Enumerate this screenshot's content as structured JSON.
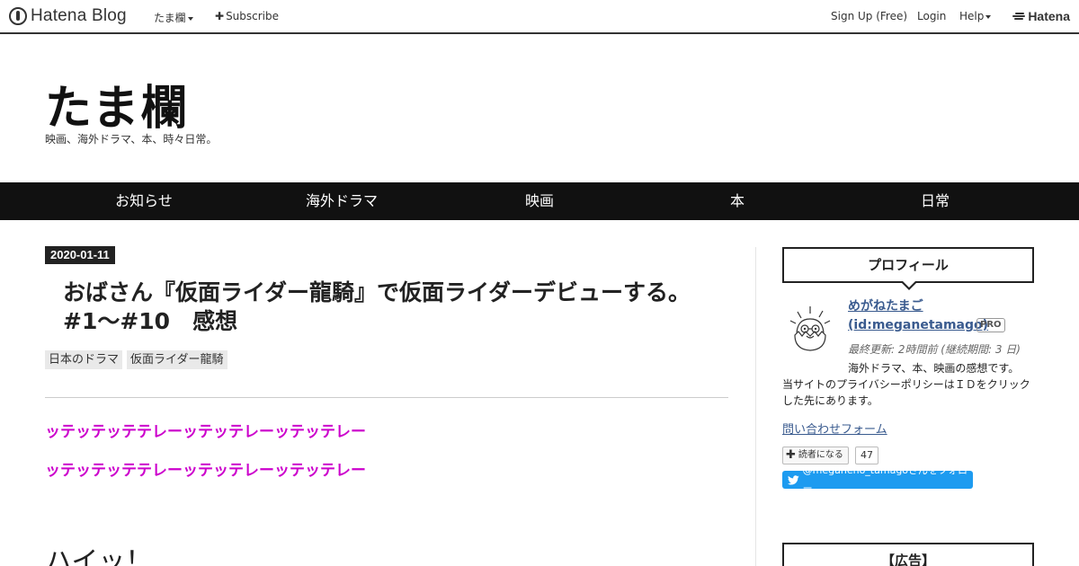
{
  "globalbar": {
    "brand": "Hatena Blog",
    "blog_menu": "たま欄",
    "subscribe": "Subscribe",
    "signup": "Sign Up (Free)",
    "login": "Login",
    "help": "Help",
    "hatena": "Hatena"
  },
  "blog": {
    "title": "たま欄",
    "description": "映画、海外ドラマ、本、時々日常。"
  },
  "nav": {
    "items": [
      "お知らせ",
      "海外ドラマ",
      "映画",
      "本",
      "日常"
    ]
  },
  "entry": {
    "date": "2020-01-11",
    "title": "おばさん『仮面ライダー龍騎』で仮面ライダーデビューする。#1～#10　感想",
    "categories": [
      "日本のドラマ",
      "仮面ライダー龍騎"
    ],
    "pink_lines": [
      "ッテッテッテテレーッテッテレーッテッテレー",
      "ッテッテッテテレーッテッテレーッテッテレー"
    ],
    "heading": "ハイッ！"
  },
  "sidebar": {
    "profile_heading": "プロフィール",
    "username": "めがねたまご",
    "user_id": "(id:meganetamago)",
    "pro_badge": "PRO",
    "updated": "最終更新: 2時間前 (継続期間: 3 日)",
    "bio_line1": "海外ドラマ、本、映画の感想です。",
    "bio_line2": "当サイトのプライバシーポリシーはＩＤをクリックした先にあります。",
    "contact_link": "問い合わせフォーム",
    "reader_button": "読者になる",
    "reader_count": "47",
    "twitter_follow": "@meganeno_tamagoさんをフォロー",
    "ad_heading": "【広告】"
  },
  "colors": {
    "accent_link": "#3a5b8f",
    "pink_text": "#cc00cc",
    "nav_bg": "#111111",
    "twitter": "#1d9bf0"
  }
}
